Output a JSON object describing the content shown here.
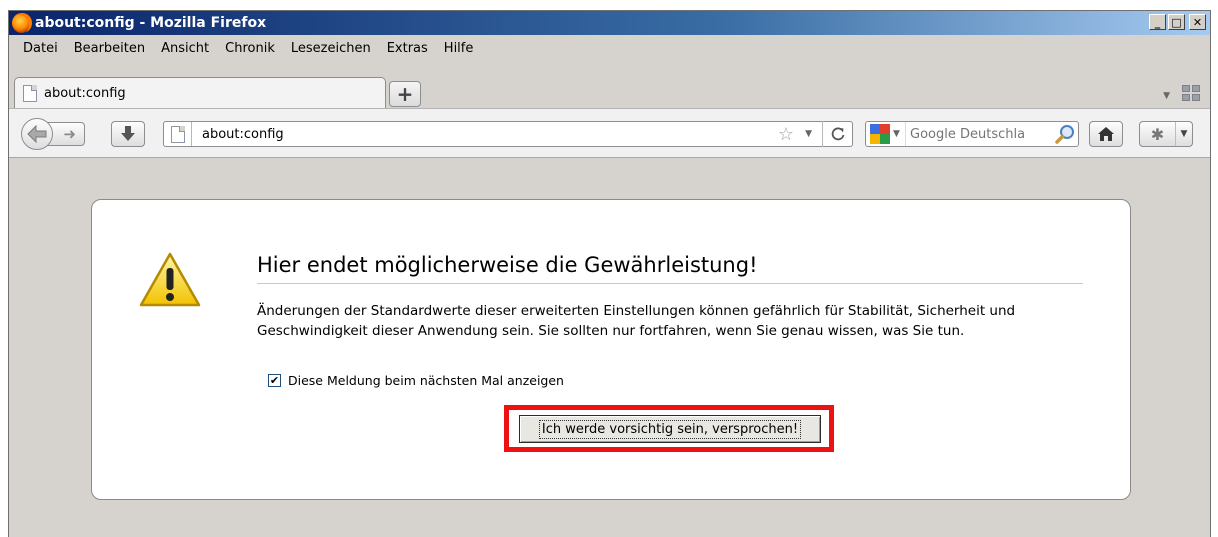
{
  "window": {
    "title": "about:config - Mozilla Firefox",
    "controls": {
      "minimize": "_",
      "maximize": "□",
      "close": "✕"
    }
  },
  "menu": [
    "Datei",
    "Bearbeiten",
    "Ansicht",
    "Chronik",
    "Lesezeichen",
    "Extras",
    "Hilfe"
  ],
  "tabs": [
    {
      "label": "about:config",
      "icon": "page-icon"
    }
  ],
  "navigation": {
    "url": "about:config",
    "search": {
      "engine": "Google",
      "placeholder": "Google Deutschla"
    }
  },
  "warning": {
    "title": "Hier endet möglicherweise die Gewährleistung!",
    "body": "Änderungen der Standardwerte dieser erweiterten Einstellungen können gefährlich für Stabilität, Sicherheit und Geschwindigkeit dieser Anwendung sein. Sie sollten nur fortfahren, wenn Sie genau wissen, was Sie tun.",
    "checkbox": {
      "label": "Diese Meldung beim nächsten Mal anzeigen",
      "checked": true
    },
    "confirm_button": "Ich werde vorsichtig sein, versprochen!",
    "highlight_color": "#ee1111"
  }
}
